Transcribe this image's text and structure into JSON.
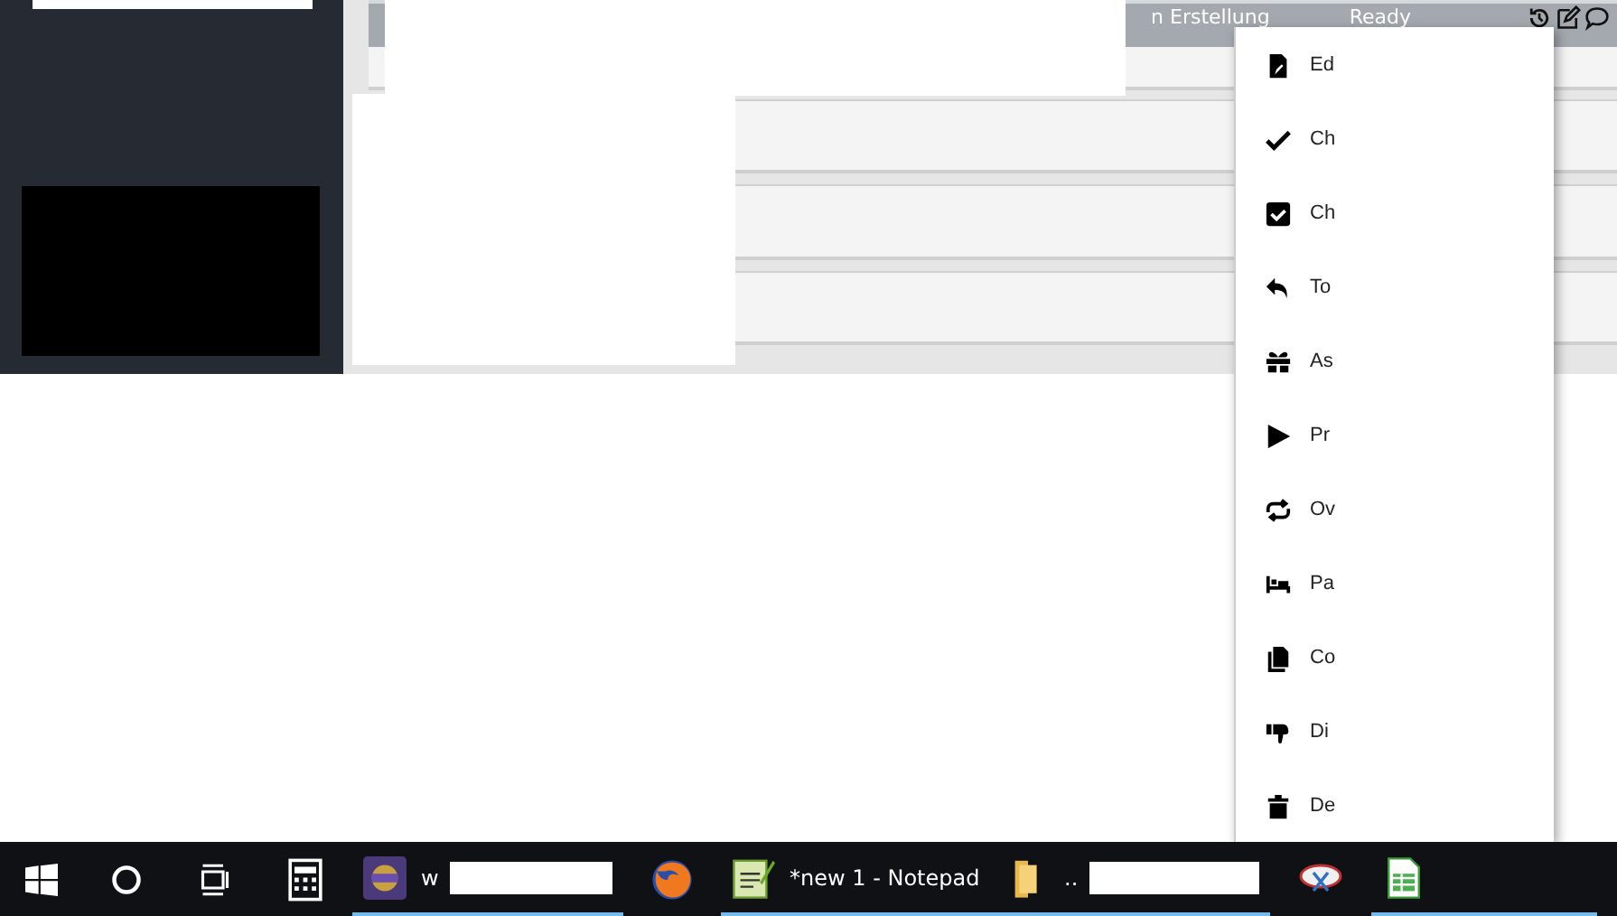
{
  "header": {
    "texts": [
      "n Erstellung",
      "Ready"
    ]
  },
  "context_menu": {
    "items": [
      {
        "kind": "edit",
        "label": "Ed"
      },
      {
        "kind": "check",
        "label": "Ch"
      },
      {
        "kind": "checkbox",
        "label": "Ch"
      },
      {
        "kind": "reply",
        "label": "To"
      },
      {
        "kind": "gift",
        "label": "As"
      },
      {
        "kind": "play",
        "label": "Pr"
      },
      {
        "kind": "repeat",
        "label": "Ov"
      },
      {
        "kind": "bed",
        "label": "Pa"
      },
      {
        "kind": "copy",
        "label": "Co"
      },
      {
        "kind": "dislike",
        "label": "Di"
      },
      {
        "kind": "delete",
        "label": "De"
      }
    ]
  },
  "taskbar": {
    "items": [
      {
        "kind": "start",
        "running": false
      },
      {
        "kind": "search",
        "running": false
      },
      {
        "kind": "taskview",
        "running": false
      },
      {
        "kind": "calculator",
        "running": false
      },
      {
        "kind": "ide",
        "label": "w",
        "running": true
      },
      {
        "kind": "browser",
        "running": false
      },
      {
        "kind": "notepad",
        "label": "*new 1 - Notepad",
        "running": true
      },
      {
        "kind": "folder",
        "label": "..",
        "running": true
      },
      {
        "kind": "scissors",
        "running": false
      },
      {
        "kind": "spreadsheet",
        "running": true
      }
    ]
  }
}
